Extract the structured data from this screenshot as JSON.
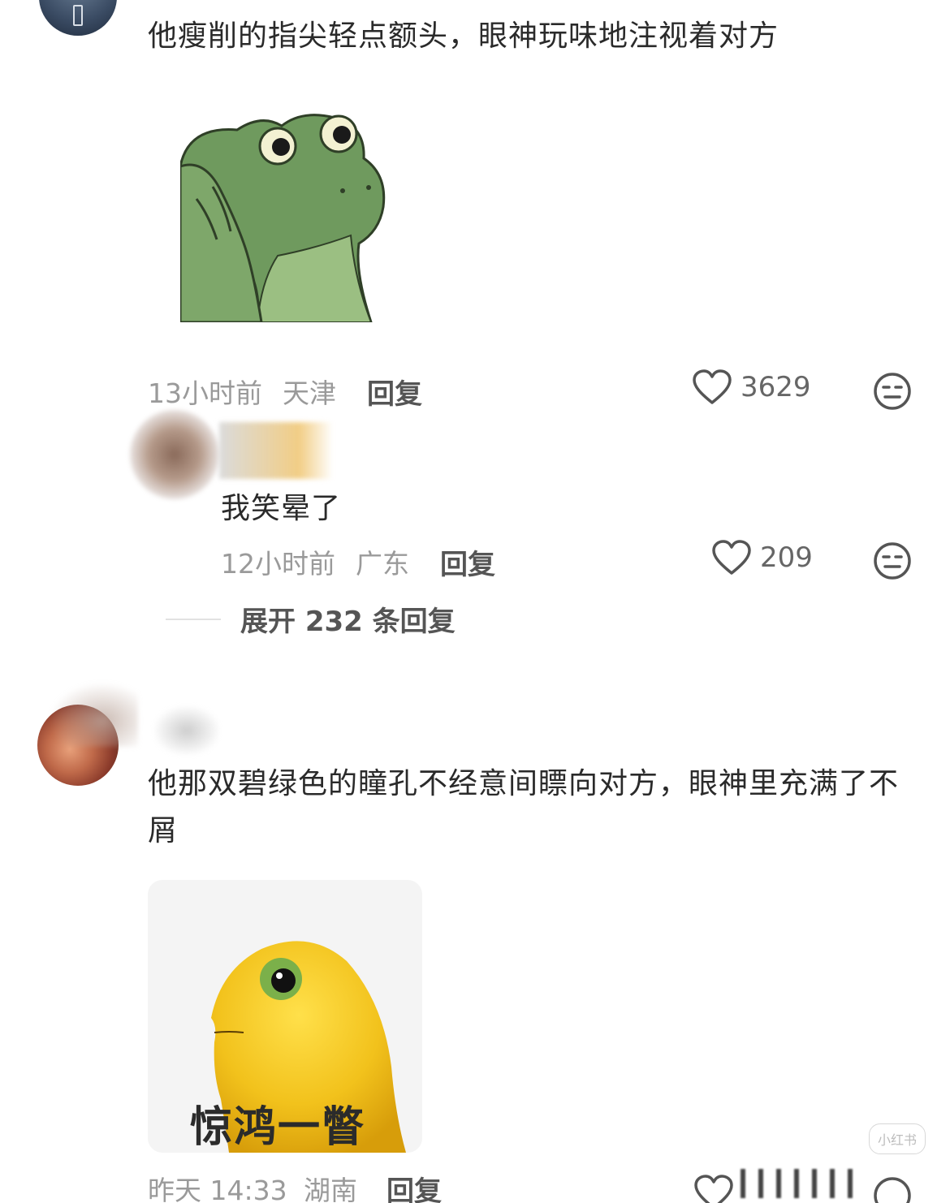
{
  "comment1": {
    "text": "他瘦削的指尖轻点额头，眼神玩味地注视着对方",
    "sticker_icon": "thinking-frog-sticker",
    "time": "13小时前",
    "location": "天津",
    "reply_label": "回复",
    "likes": "3629"
  },
  "reply1": {
    "text": "我笑晕了",
    "time": "12小时前",
    "location": "广东",
    "reply_label": "回复",
    "likes": "209"
  },
  "expand_label": "展开 232 条回复",
  "comment2": {
    "text": "他那双碧绿色的瞳孔不经意间瞟向对方，眼神里充满了不屑",
    "sticker_icon": "yellow-blob-side-eye-sticker",
    "sticker_caption": "惊鸿一瞥",
    "time": "昨天 14:33",
    "location": "湖南",
    "reply_label": "回复"
  },
  "watermark": "小红书",
  "colors": {
    "text": "#2a2a2a",
    "meta": "#9a9a9a",
    "frog_green": "#6f9a5e",
    "blob_yellow": "#f2c21c"
  }
}
